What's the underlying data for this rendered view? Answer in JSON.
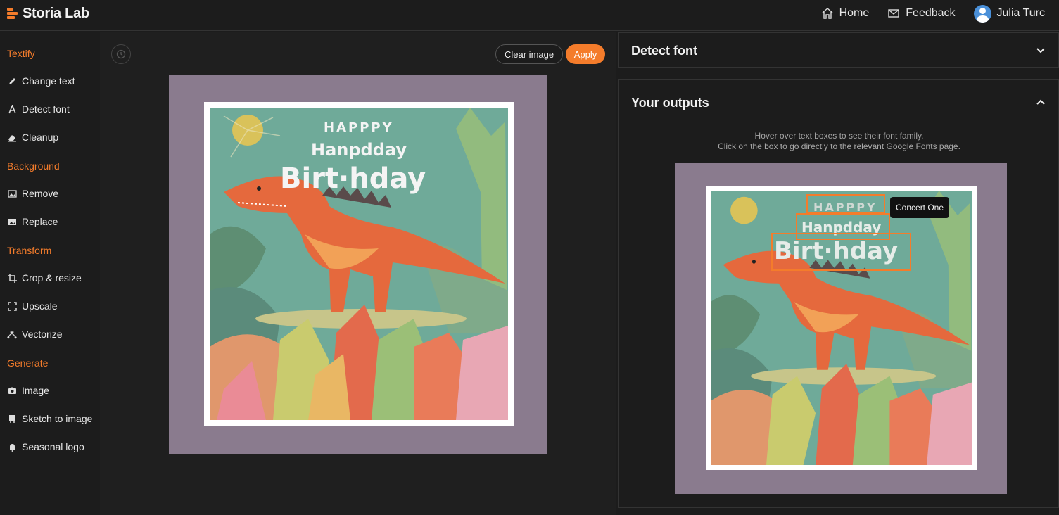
{
  "app": {
    "name": "Storia Lab"
  },
  "nav": {
    "home": "Home",
    "feedback": "Feedback",
    "user": "Julia Turc"
  },
  "sidebar": {
    "sections": [
      {
        "title": "Textify",
        "items": [
          "Change text",
          "Detect font",
          "Cleanup"
        ]
      },
      {
        "title": "Background",
        "items": [
          "Remove",
          "Replace"
        ]
      },
      {
        "title": "Transform",
        "items": [
          "Crop & resize",
          "Upscale",
          "Vectorize"
        ]
      },
      {
        "title": "Generate",
        "items": [
          "Image",
          "Sketch to image",
          "Seasonal logo"
        ]
      }
    ]
  },
  "toolbar": {
    "clear": "Clear image",
    "apply": "Apply"
  },
  "card": {
    "line1": "HAPPPY",
    "line2": "Hanpdday",
    "line3": "Birt·hday"
  },
  "panels": {
    "detect": "Detect font",
    "outputs": "Your outputs",
    "hint1": "Hover over text boxes to see their font family.",
    "hint2": "Click on the box to go directly to the relevant Google Fonts page.",
    "tooltip": "Concert One"
  },
  "colors": {
    "accent": "#f47c2b",
    "frame": "#8a7b8e",
    "card_bg": "#6faa99"
  }
}
